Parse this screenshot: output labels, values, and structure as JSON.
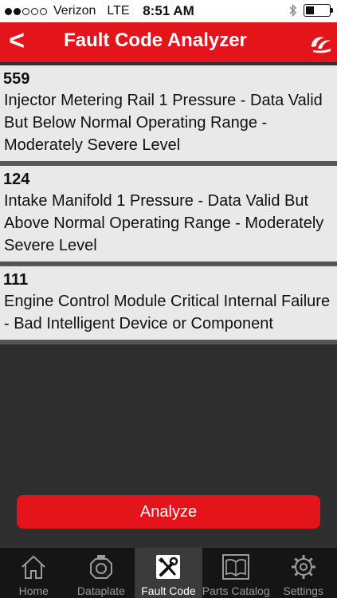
{
  "status": {
    "carrier": "Verizon",
    "network": "LTE",
    "time": "8:51 AM"
  },
  "header": {
    "back": "<",
    "title": "Fault Code Analyzer"
  },
  "faults": [
    {
      "code": "559",
      "description": "Injector Metering Rail 1 Pressure - Data Valid But Below Normal Operating Range - Moderately Severe Level"
    },
    {
      "code": "124",
      "description": "Intake Manifold 1 Pressure - Data Valid But Above Normal Operating Range - Moderately Severe Level"
    },
    {
      "code": "111",
      "description": "Engine Control Module Critical Internal Failure - Bad Intelligent Device or Component"
    }
  ],
  "actions": {
    "analyze": "Analyze"
  },
  "tabs": [
    {
      "label": "Home",
      "icon": "home-icon"
    },
    {
      "label": "Dataplate",
      "icon": "engine-icon"
    },
    {
      "label": "Fault Code",
      "icon": "tools-icon",
      "active": true
    },
    {
      "label": "Parts Catalog",
      "icon": "book-icon"
    },
    {
      "label": "Settings",
      "icon": "gear-icon"
    }
  ],
  "colors": {
    "accent": "#e4141b",
    "background": "#2e2e2e",
    "card": "#e9e9e9",
    "tabbar": "#151515"
  }
}
